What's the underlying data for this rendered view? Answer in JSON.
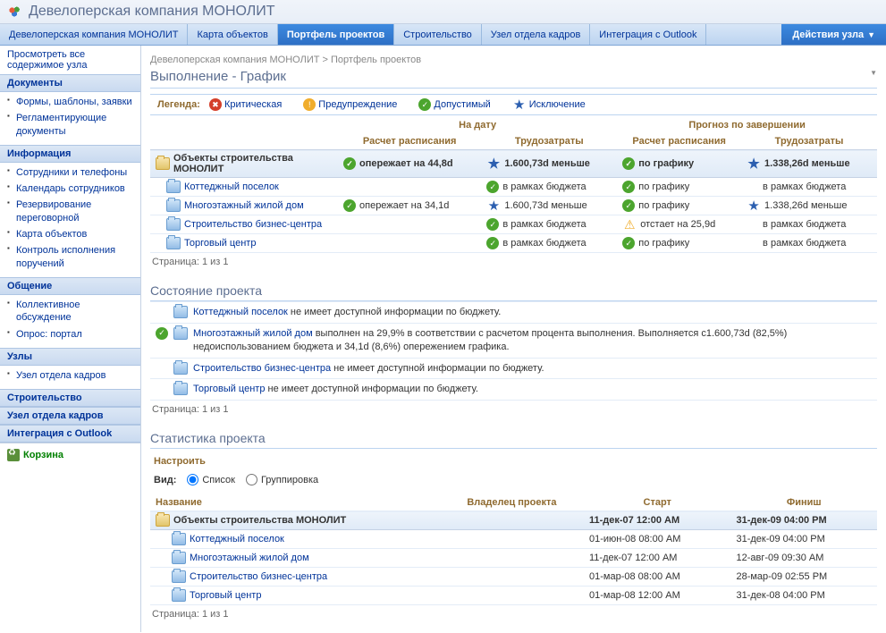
{
  "header": {
    "title": "Девелоперская компания МОНОЛИТ"
  },
  "topnav": {
    "tabs": [
      "Девелоперская компания МОНОЛИТ",
      "Карта объектов",
      "Портфель проектов",
      "Строительство",
      "Узел отдела кадров",
      "Интеграция с Outlook"
    ],
    "active": 2,
    "actions": "Действия узла"
  },
  "sidebar": {
    "viewAll": "Просмотреть все содержимое узла",
    "sections": [
      {
        "title": "Документы",
        "items": [
          "Формы, шаблоны, заявки",
          "Регламентирующие документы"
        ]
      },
      {
        "title": "Информация",
        "items": [
          "Сотрудники и телефоны",
          "Календарь сотрудников",
          "Резервирование переговорной",
          "Карта объектов",
          "Контроль исполнения поручений"
        ]
      },
      {
        "title": "Общение",
        "items": [
          "Коллективное обсуждение",
          "Опрос: портал"
        ]
      },
      {
        "title": "Узлы",
        "items": [
          "Узел отдела кадров"
        ]
      },
      {
        "title": "Строительство",
        "items": []
      },
      {
        "title": "Узел отдела кадров",
        "items": []
      },
      {
        "title": "Интеграция с Outlook",
        "items": []
      }
    ],
    "recycle": "Корзина"
  },
  "breadcrumb": {
    "root": "Девелоперская компания МОНОЛИТ",
    "sep": ">",
    "leaf": "Портфель проектов"
  },
  "pageTitle": "Выполнение - График",
  "legend": {
    "label": "Легенда:",
    "items": [
      {
        "kind": "critical",
        "text": "Критическая"
      },
      {
        "kind": "warn",
        "text": "Предупреждение"
      },
      {
        "kind": "ok",
        "text": "Допустимый"
      },
      {
        "kind": "star",
        "text": "Исключение"
      }
    ]
  },
  "grid": {
    "groupHead": {
      "left": "На дату",
      "right": "Прогноз по завершении"
    },
    "cols": {
      "calc": "Расчет расписания",
      "effort": "Трудозатраты"
    },
    "category": "Объекты строительства МОНОЛИТ",
    "catRow": {
      "c1": {
        "icon": "ok",
        "text": "опережает на 44,8d"
      },
      "c2": {
        "icon": "star",
        "text": "1.600,73d меньше"
      },
      "c3": {
        "icon": "ok",
        "text": "по графику"
      },
      "c4": {
        "icon": "star",
        "text": "1.338,26d меньше"
      }
    },
    "rows": [
      {
        "name": "Коттеджный поселок",
        "c1": null,
        "c2": {
          "icon": "ok",
          "text": "в рамках бюджета"
        },
        "c3": {
          "icon": "ok",
          "text": "по графику"
        },
        "c4": {
          "icon": "",
          "text": "в рамках бюджета"
        }
      },
      {
        "name": "Многоэтажный жилой дом",
        "c1": {
          "icon": "ok",
          "text": "опережает на 34,1d"
        },
        "c2": {
          "icon": "star",
          "text": "1.600,73d меньше"
        },
        "c3": {
          "icon": "ok",
          "text": "по графику"
        },
        "c4": {
          "icon": "star",
          "text": "1.338,26d меньше"
        }
      },
      {
        "name": "Строительство бизнес-центра",
        "c1": null,
        "c2": {
          "icon": "ok",
          "text": "в рамках бюджета"
        },
        "c3": {
          "icon": "warn-tri",
          "text": "отстает на 25,9d"
        },
        "c4": {
          "icon": "",
          "text": "в рамках бюджета"
        }
      },
      {
        "name": "Торговый центр",
        "c1": null,
        "c2": {
          "icon": "ok",
          "text": "в рамках бюджета"
        },
        "c3": {
          "icon": "ok",
          "text": "по графику"
        },
        "c4": {
          "icon": "",
          "text": "в рамках бюджета"
        }
      }
    ],
    "pager": "Страница: 1 из 1"
  },
  "status": {
    "title": "Состояние проекта",
    "rows": [
      {
        "icon": null,
        "link": "Коттеджный поселок",
        "text": " не имеет доступной информации по бюджету."
      },
      {
        "icon": "ok",
        "link": "Многоэтажный жилой дом",
        "text": " выполнен на 29,9% в соответствии с расчетом процента выполнения. Выполняется с1.600,73d (82,5%) недоиспользованием бюджета и 34,1d (8,6%) опережением графика."
      },
      {
        "icon": null,
        "link": "Строительство бизнес-центра",
        "text": " не имеет доступной информации по бюджету."
      },
      {
        "icon": null,
        "link": "Торговый центр",
        "text": " не имеет доступной информации по бюджету."
      }
    ],
    "pager": "Страница: 1 из 1"
  },
  "stats": {
    "title": "Статистика проекта",
    "configure": "Настроить",
    "viewLabel": "Вид:",
    "viewList": "Список",
    "viewGroup": "Группировка",
    "cols": {
      "name": "Название",
      "owner": "Владелец проекта",
      "start": "Старт",
      "finish": "Финиш"
    },
    "category": "Объекты строительства МОНОЛИТ",
    "catRow": {
      "start": "11-дек-07 12:00 AM",
      "finish": "31-дек-09 04:00 PM"
    },
    "rows": [
      {
        "name": "Коттеджный поселок",
        "owner": "",
        "start": "01-июн-08 08:00 AM",
        "finish": "31-дек-09 04:00 PM"
      },
      {
        "name": "Многоэтажный жилой дом",
        "owner": "",
        "start": "11-дек-07 12:00 AM",
        "finish": "12-авг-09 09:30 AM"
      },
      {
        "name": "Строительство бизнес-центра",
        "owner": "",
        "start": "01-мар-08 08:00 AM",
        "finish": "28-мар-09 02:55 PM"
      },
      {
        "name": "Торговый центр",
        "owner": "",
        "start": "01-мар-08 12:00 AM",
        "finish": "31-дек-08 04:00 PM"
      }
    ],
    "pager": "Страница: 1 из 1"
  }
}
